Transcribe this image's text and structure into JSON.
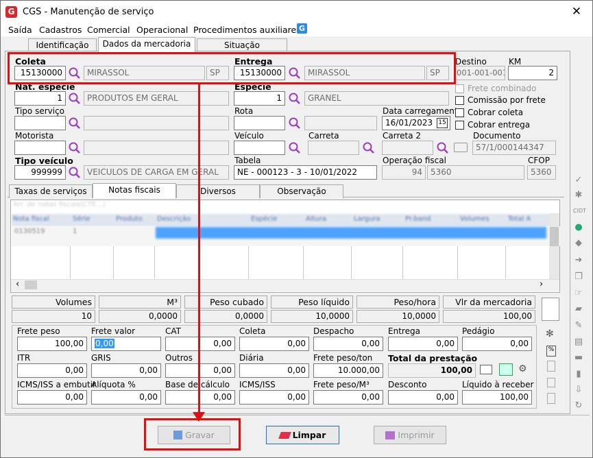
{
  "window": {
    "title": "CGS - Manutenção de serviço",
    "logo_letter": "G",
    "close": "✕"
  },
  "menu": [
    "Saída",
    "Cadastros",
    "Comercial",
    "Operacional",
    "Procedimentos auxiliares"
  ],
  "menu_icon": "G",
  "tabs": [
    "Identificação",
    "Dados da mercadoria",
    "Situação"
  ],
  "labels": {
    "coleta": "Coleta",
    "entrega": "Entrega",
    "destino": "Destino",
    "km": "KM",
    "nat_especie": "Nat. espécie",
    "especie": "Espécie",
    "frete_combinado": "Frete combinado",
    "comissao": "Comissão por frete",
    "tipo_servico": "Tipo serviço",
    "rota": "Rota",
    "data_carregamento": "Data carregamento",
    "cobrar_coleta": "Cobrar coleta",
    "cobrar_entrega": "Cobrar entrega",
    "motorista": "Motorista",
    "veiculo": "Veículo",
    "carreta": "Carreta",
    "carreta2": "Carreta 2",
    "documento": "Documento",
    "tipo_veiculo": "Tipo veículo",
    "tabela": "Tabela",
    "operacao_fiscal": "Operação fiscal",
    "cfop": "CFOP"
  },
  "fields": {
    "coleta_code": "15130000",
    "coleta_city": "MIRASSOL",
    "coleta_uf": "SP",
    "entrega_code": "15130000",
    "entrega_city": "MIRASSOL",
    "entrega_uf": "SP",
    "destino": "001-001-001",
    "km": "2",
    "nat_especie_code": "1",
    "nat_especie_desc": "PRODUTOS EM GERAL",
    "especie_code": "1",
    "especie_desc": "GRANEL",
    "data_carregamento": "16/01/2023",
    "cal_icon": "15",
    "documento": "57/1/000144347",
    "tipo_veiculo_code": "999999",
    "tipo_veiculo_desc": "VEICULOS DE CARGA EM GERAL",
    "tabela": "NE - 000123 - 3 - 10/01/2022",
    "operacao_code": "94",
    "operacao_desc": "5360",
    "cfop": "5360"
  },
  "subtabs": [
    "Taxas de serviços",
    "Notas fiscais",
    "Diversos",
    "Observação"
  ],
  "grid": {
    "hint": "Arr. de notas fiscais(CTE...)",
    "headers": [
      "Nota fiscal",
      "Série",
      "Produto",
      "Descrição",
      "Espécie",
      "Altura",
      "Largura",
      "Pr.band",
      "Volumes",
      "Total A"
    ],
    "row": [
      "0130519",
      "1",
      "",
      "",
      "",
      "",
      "",
      "",
      "",
      ""
    ]
  },
  "summary": {
    "headers": [
      "Volumes",
      "M³",
      "Peso cubado",
      "Peso líquido",
      "Peso/hora",
      "Vlr da mercadoria"
    ],
    "values": [
      "10",
      "0,0000",
      "0,0000",
      "10,0000",
      "10,0000",
      "100,00"
    ]
  },
  "fees": {
    "row1": [
      {
        "l": "Frete peso",
        "v": "100,00"
      },
      {
        "l": "Frete valor",
        "v": "0,00"
      },
      {
        "l": "CAT",
        "v": "0,00"
      },
      {
        "l": "Coleta",
        "v": "0,00"
      },
      {
        "l": "Despacho",
        "v": "0,00"
      },
      {
        "l": "Entrega",
        "v": "0,00"
      },
      {
        "l": "Pedágio",
        "v": "0,00"
      }
    ],
    "row2": [
      {
        "l": "ITR",
        "v": "0,00"
      },
      {
        "l": "GRIS",
        "v": "0,00"
      },
      {
        "l": "Outros",
        "v": "0,00"
      },
      {
        "l": "Diária",
        "v": "0,00"
      },
      {
        "l": "Frete peso/ton",
        "v": "10.000,00"
      },
      {
        "l": "Total da prestação",
        "v": "100,00"
      }
    ],
    "row3": [
      {
        "l": "ICMS/ISS a embutir",
        "v": "0,00"
      },
      {
        "l": "Alíquota %",
        "v": "0,00"
      },
      {
        "l": "Base de cálculo",
        "v": "0,00"
      },
      {
        "l": "ICMS/ISS",
        "v": "0,00"
      },
      {
        "l": "Frete peso/M³",
        "v": "0,00"
      },
      {
        "l": "Desconto",
        "v": "0,00"
      },
      {
        "l": "Líquido à receber",
        "v": "100,00"
      }
    ]
  },
  "buttons": {
    "gravar": "Gravar",
    "limpar": "Limpar",
    "imprimir": "Imprimir"
  },
  "colors": {
    "highlight": "#e01010",
    "accent": "#3399ff",
    "logo": "#d9262e"
  }
}
